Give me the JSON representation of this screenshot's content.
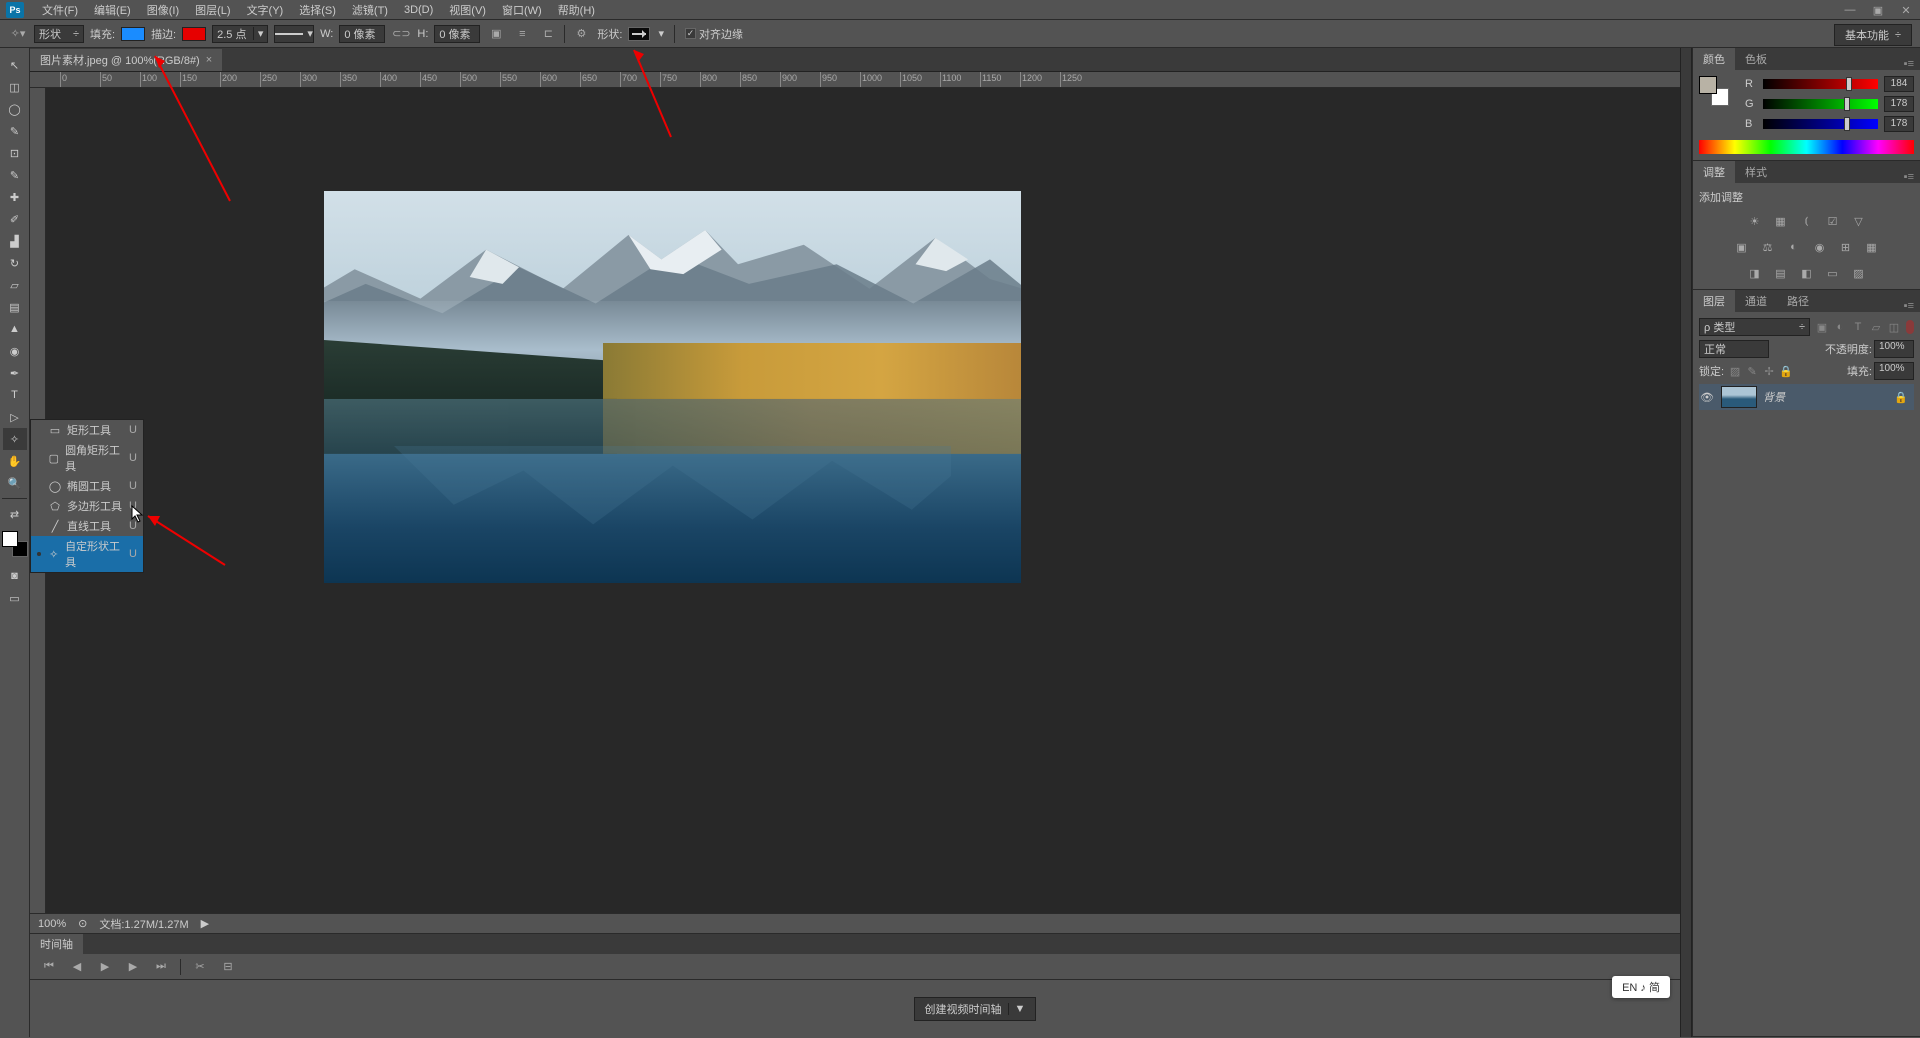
{
  "menu": {
    "items": [
      "文件(F)",
      "编辑(E)",
      "图像(I)",
      "图层(L)",
      "文字(Y)",
      "选择(S)",
      "滤镜(T)",
      "3D(D)",
      "视图(V)",
      "窗口(W)",
      "帮助(H)"
    ]
  },
  "options": {
    "mode_label": "形状",
    "fill_label": "填充:",
    "stroke_label": "描边:",
    "stroke_width": "2.5 点",
    "w_label": "W:",
    "w_value": "0 像素",
    "h_label": "H:",
    "h_value": "0 像素",
    "shape_label": "形状:",
    "align_label": "对齐边缘",
    "workspace": "基本功能"
  },
  "document": {
    "tab_title": "图片素材.jpeg @ 100%(RGB/8#)",
    "zoom": "100%",
    "doc_size": "文档:1.27M/1.27M"
  },
  "shape_flyout": {
    "items": [
      {
        "label": "矩形工具",
        "shortcut": "U"
      },
      {
        "label": "圆角矩形工具",
        "shortcut": "U"
      },
      {
        "label": "椭圆工具",
        "shortcut": "U"
      },
      {
        "label": "多边形工具",
        "shortcut": "U"
      },
      {
        "label": "直线工具",
        "shortcut": "U"
      },
      {
        "label": "自定形状工具",
        "shortcut": "U"
      }
    ]
  },
  "timeline": {
    "tab": "时间轴",
    "create_btn": "创建视频时间轴"
  },
  "ime": {
    "text": "EN ♪ 简"
  },
  "panels": {
    "color_tab": "颜色",
    "swatch_tab": "色板",
    "r_label": "R",
    "r_value": "184",
    "g_label": "G",
    "g_value": "178",
    "b_label": "B",
    "b_value": "178",
    "adjust_tab": "调整",
    "styles_tab": "样式",
    "adjust_label": "添加调整",
    "layers_tab": "图层",
    "channels_tab": "通道",
    "paths_tab": "路径",
    "filter_type": "ρ 类型",
    "blend_mode": "正常",
    "opacity_label": "不透明度:",
    "opacity_value": "100%",
    "lock_label": "锁定:",
    "fill_label2": "填充:",
    "fill_value": "100%",
    "layer_name": "背景"
  },
  "ruler_marks": [
    "0",
    "50",
    "100",
    "150",
    "200",
    "250",
    "300",
    "350",
    "400",
    "450",
    "500",
    "550",
    "600",
    "650",
    "700",
    "750",
    "800",
    "850",
    "900",
    "950",
    "1000",
    "1050",
    "1100",
    "1150",
    "1200",
    "1250"
  ]
}
